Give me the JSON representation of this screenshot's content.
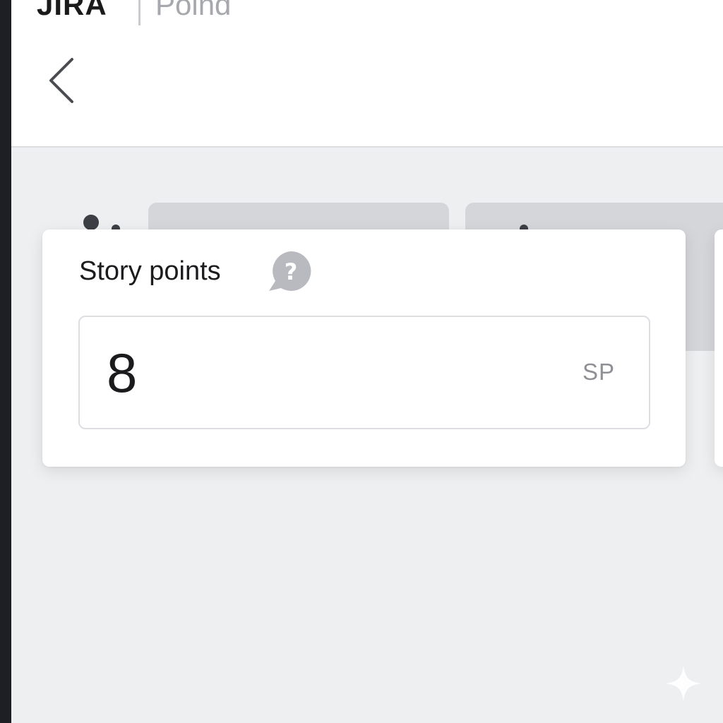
{
  "header": {
    "brand": "JIRA",
    "project": "Poind",
    "back_icon": "chevron-left-icon"
  },
  "story_points": {
    "label": "Story points",
    "help_icon": "help-question-icon",
    "value": "8",
    "unit": "SP"
  },
  "colors": {
    "background": "#eeeff1",
    "surface": "#ffffff",
    "text": "#1c1c1e",
    "muted": "#8e9096",
    "help_bubble": "#b9bac0"
  }
}
